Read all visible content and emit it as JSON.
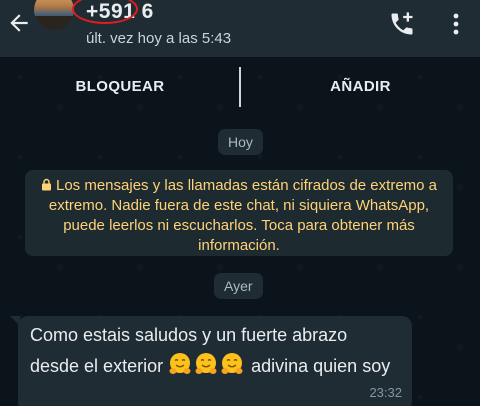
{
  "header": {
    "title": "+591 6",
    "status": "últ. vez hoy a las 5:43",
    "icons": [
      "back-arrow-icon",
      "avatar",
      "add-call-icon",
      "more-vert-icon"
    ]
  },
  "actions": {
    "block_label": "BLOQUEAR",
    "add_label": "AÑADIR"
  },
  "chat": {
    "date_today": "Hoy",
    "encryption_notice": "Los mensajes y las llamadas están cifrados de extremo a extremo. Nadie fuera de este chat, ni siquiera WhatsApp, puede leerlos ni escucharlos. Toca para obtener más información.",
    "date_yesterday": "Ayer",
    "message": {
      "text_before": "Como estais saludos y un fuerte abrazo desde el exterior",
      "emojis": [
        "hugging-face-emoji",
        "hugging-face-emoji",
        "hugging-face-emoji"
      ],
      "text_after": " adivina quien soy",
      "time": "23:32"
    }
  },
  "colors": {
    "background": "#0b141a",
    "header": "#1f2c34",
    "bubble": "#1f2c34",
    "encryption_text": "#ffd279",
    "highlight_circle": "#e01e1e"
  }
}
